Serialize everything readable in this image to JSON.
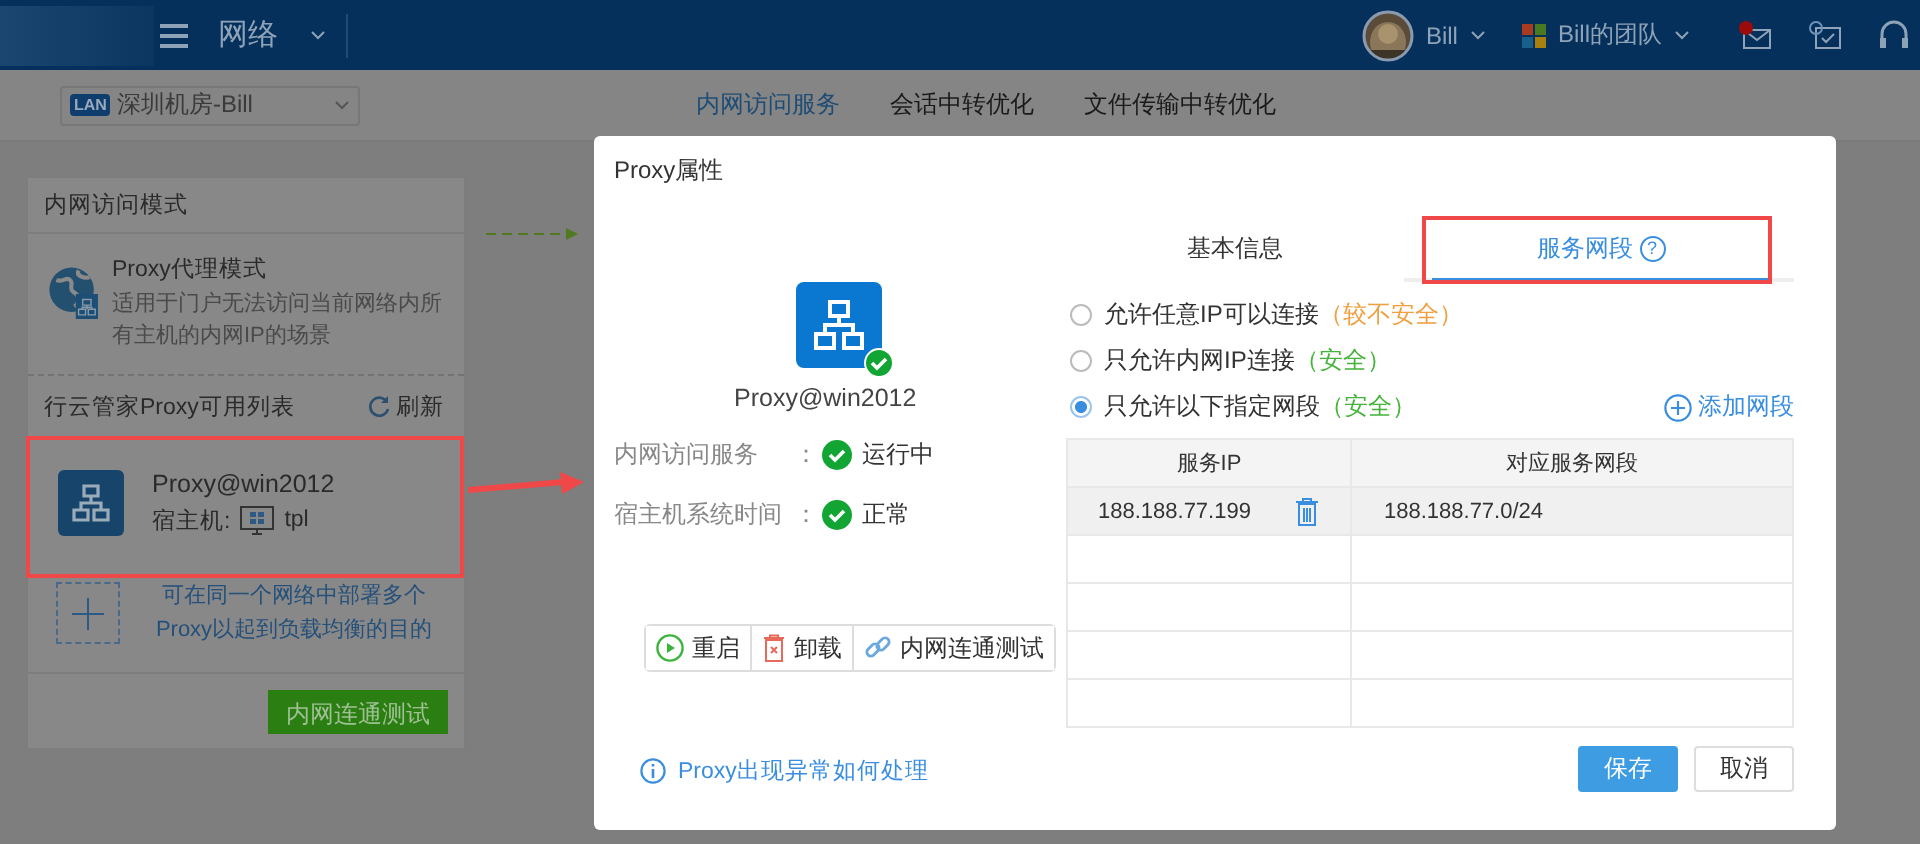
{
  "topbar": {
    "section": "网络",
    "user": "Bill",
    "team": "Bill的团队",
    "mail_unread": true
  },
  "subbar": {
    "location_badge": "LAN",
    "location": "深圳机房-Bill",
    "tabs": [
      {
        "label": "内网访问服务",
        "selected": true
      },
      {
        "label": "会话中转优化",
        "selected": false
      },
      {
        "label": "文件传输中转优化",
        "selected": false
      }
    ]
  },
  "left_panel": {
    "title": "内网访问模式",
    "mode": {
      "name": "Proxy代理模式",
      "description": "适用于门户无法访问当前网络内所有主机的内网IP的场景"
    },
    "list_title": "行云管家Proxy可用列表",
    "refresh": "刷新",
    "proxies": [
      {
        "name": "Proxy@win2012",
        "host_label": "宿主机:",
        "host": "tpl"
      }
    ],
    "add_hint": "可在同一个网络中部署多个Proxy以起到负载均衡的目的",
    "test_button": "内网连通测试"
  },
  "dialog": {
    "title": "Proxy属性",
    "proxy_name": "Proxy@win2012",
    "online": true,
    "status": [
      {
        "label": "内网访问服务",
        "separator": "：",
        "value": "运行中",
        "ok": true
      },
      {
        "label": "宿主机系统时间",
        "separator": "：",
        "value": "正常",
        "ok": true
      }
    ],
    "actions": [
      {
        "kind": "restart",
        "label": "重启"
      },
      {
        "kind": "uninstall",
        "label": "卸载"
      },
      {
        "kind": "link",
        "label": "内网连通测试"
      }
    ],
    "help_link": "Proxy出现异常如何处理",
    "tabs": [
      {
        "label": "基本信息",
        "selected": false
      },
      {
        "label": "服务网段",
        "selected": true,
        "help": "?"
      }
    ],
    "options": [
      {
        "label": "允许任意IP可以连接",
        "note": "（较不安全）",
        "color": "#f0a040",
        "selected": false
      },
      {
        "label": "只允许内网IP连接",
        "note": "（安全）",
        "color": "#46b43c",
        "selected": false
      },
      {
        "label": "只允许以下指定网段",
        "note": "（安全）",
        "color": "#46b43c",
        "selected": true
      }
    ],
    "add_segment": "添加网段",
    "table": {
      "columns": [
        "服务IP",
        "对应服务网段"
      ],
      "rows": [
        {
          "ip": "188.188.77.199",
          "segment": "188.188.77.0/24",
          "selected": true
        }
      ]
    },
    "buttons": [
      {
        "kind": "primary",
        "label": "保存"
      },
      {
        "kind": "default",
        "label": "取消"
      }
    ]
  }
}
